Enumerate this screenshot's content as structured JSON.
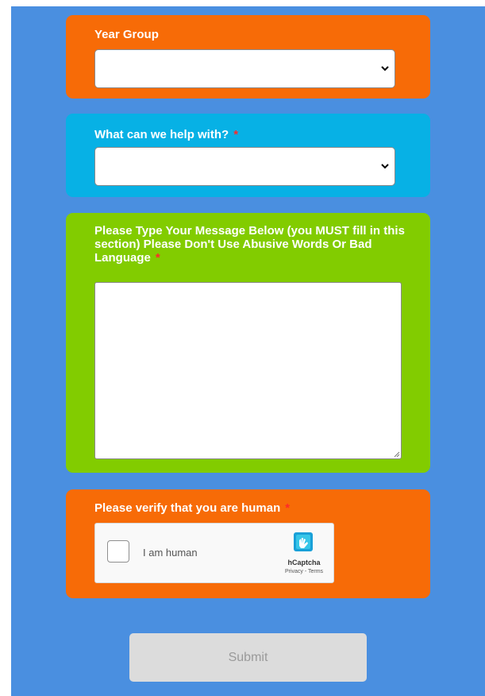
{
  "form": {
    "year_group": {
      "label": "Year Group",
      "value": ""
    },
    "help_with": {
      "label": "What can we help with?",
      "required_mark": "*",
      "value": ""
    },
    "message": {
      "label": "Please Type Your Message Below (you MUST fill in this section) Please Don't Use Abusive Words Or Bad Language",
      "required_mark": "*",
      "value": ""
    },
    "verify": {
      "label": "Please verify that you are human",
      "required_mark": "*",
      "checkbox_label": "I am human",
      "brand": "hCaptcha",
      "links": "Privacy - Terms"
    },
    "submit_label": "Submit"
  },
  "colors": {
    "background": "#4a8fe0",
    "orange": "#f76b07",
    "blue": "#07b1e5",
    "green": "#82cc00",
    "required": "#ff2a2a"
  }
}
